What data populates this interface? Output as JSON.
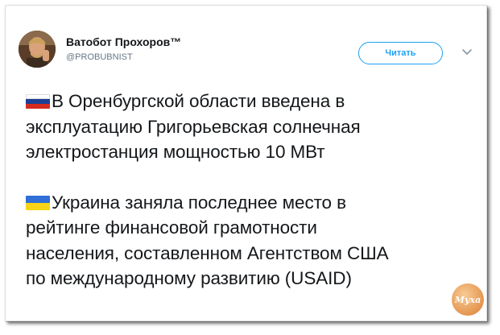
{
  "tweet": {
    "author": {
      "name": "Ватобот Прохоров™",
      "handle": "@PROBUBNIST"
    },
    "follow_label": "Читать",
    "paragraphs": [
      {
        "flag": "russia",
        "line1": "В Оренбургской области введена в",
        "line2": "эксплуатацию Григорьевская солнечная",
        "line3": "электростанция мощностью 10 МВт"
      },
      {
        "flag": "ukraine",
        "line1": "Украина заняла последнее место в",
        "line2": "рейтинге финансовой грамотности",
        "line3": "населения, составленном Агентством США",
        "line4": "по международному развитию (USAID)"
      }
    ]
  },
  "watermark_text": "Муха",
  "colors": {
    "accent": "#1da1f2",
    "text": "#14171a",
    "secondary": "#657786"
  },
  "icons": {
    "caret": "chevron-down-icon",
    "flag_ru": "russia-flag-icon",
    "flag_ua": "ukraine-flag-icon"
  }
}
